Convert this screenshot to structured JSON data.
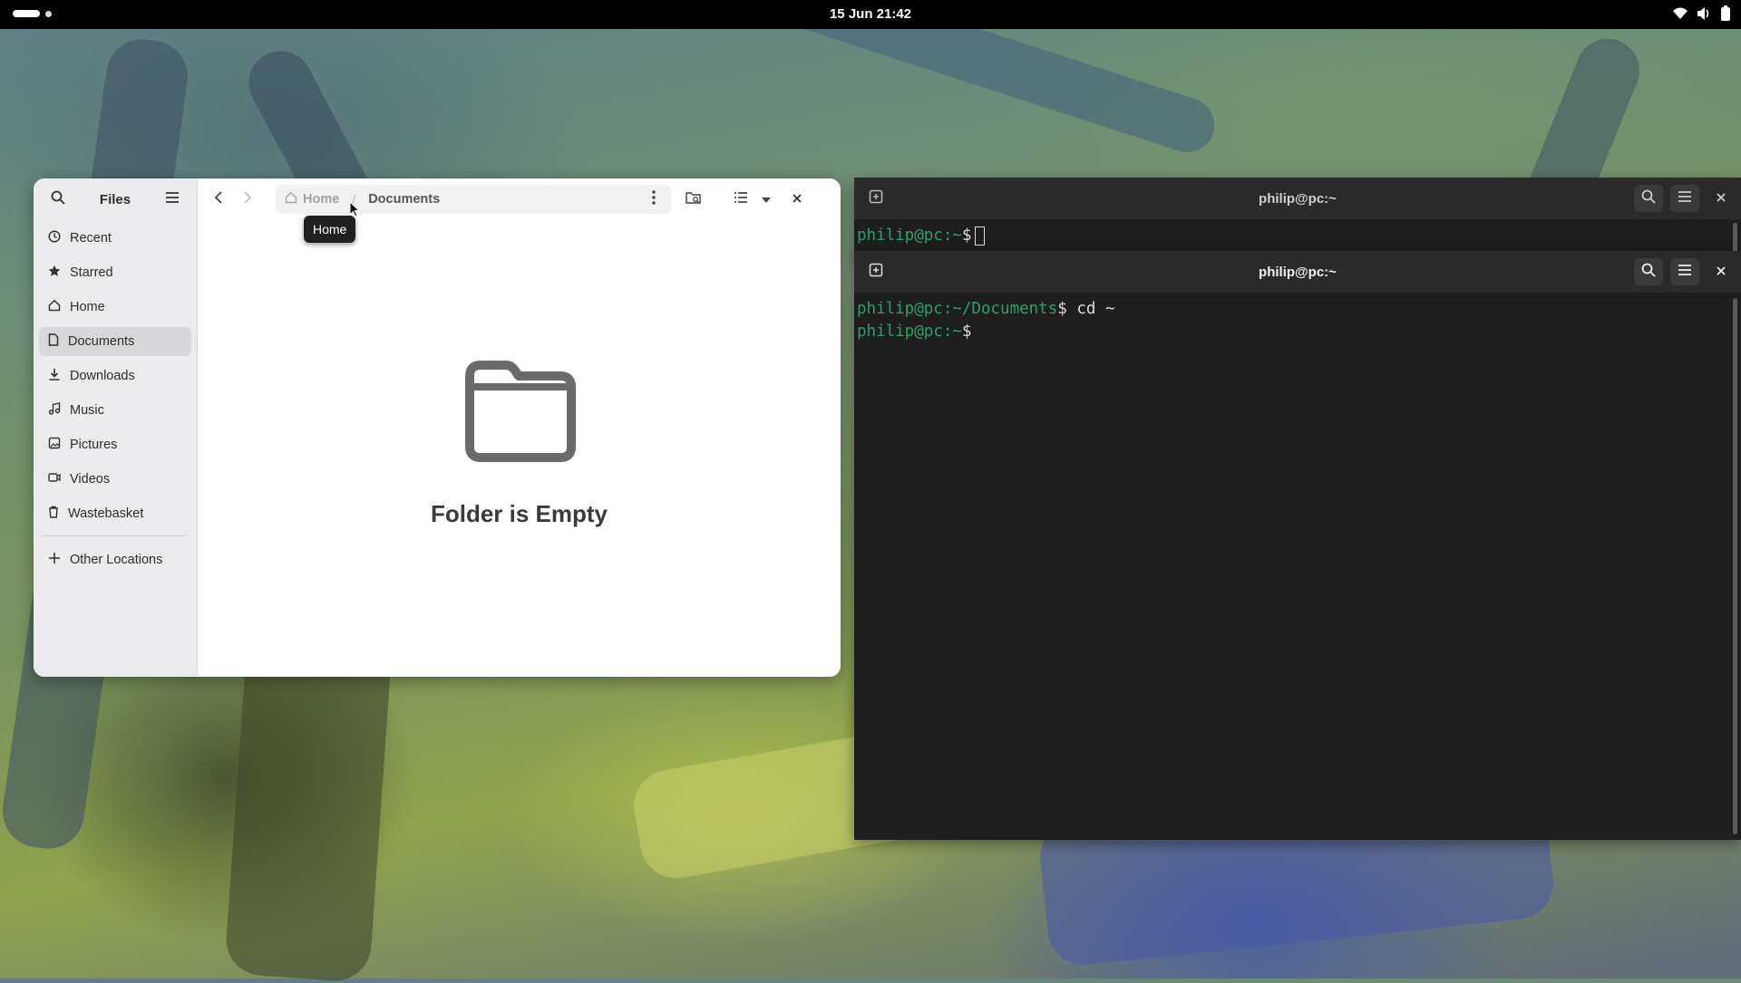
{
  "topbar": {
    "clock": "15 Jun  21:42"
  },
  "files": {
    "sidebar_title": "Files",
    "sidebar_items": [
      {
        "label": "Recent",
        "icon": "clock-icon"
      },
      {
        "label": "Starred",
        "icon": "star-icon"
      },
      {
        "label": "Home",
        "icon": "home-icon"
      },
      {
        "label": "Documents",
        "icon": "document-icon",
        "active": true
      },
      {
        "label": "Downloads",
        "icon": "download-icon"
      },
      {
        "label": "Music",
        "icon": "music-icon"
      },
      {
        "label": "Pictures",
        "icon": "picture-icon"
      },
      {
        "label": "Videos",
        "icon": "video-icon"
      },
      {
        "label": "Wastebasket",
        "icon": "trash-icon"
      }
    ],
    "other_locations": "Other Locations",
    "path": {
      "home": "Home",
      "separator": "/",
      "current": "Documents"
    },
    "empty_title": "Folder is Empty",
    "tooltip": "Home"
  },
  "terminal_back": {
    "title": "philip@pc:~",
    "prompt": "philip@pc:~",
    "symbol": "$"
  },
  "terminal_front": {
    "title": "philip@pc:~",
    "line1_prompt": "philip@pc:~/Documents",
    "line1_symbol": "$",
    "line1_command": " cd ~",
    "line2_prompt": "philip@pc:~",
    "line2_symbol": "$"
  },
  "colors": {
    "prompt_green": "#26a269",
    "terminal_bg": "#1e1e1e",
    "topbar_bg": "#000000"
  }
}
